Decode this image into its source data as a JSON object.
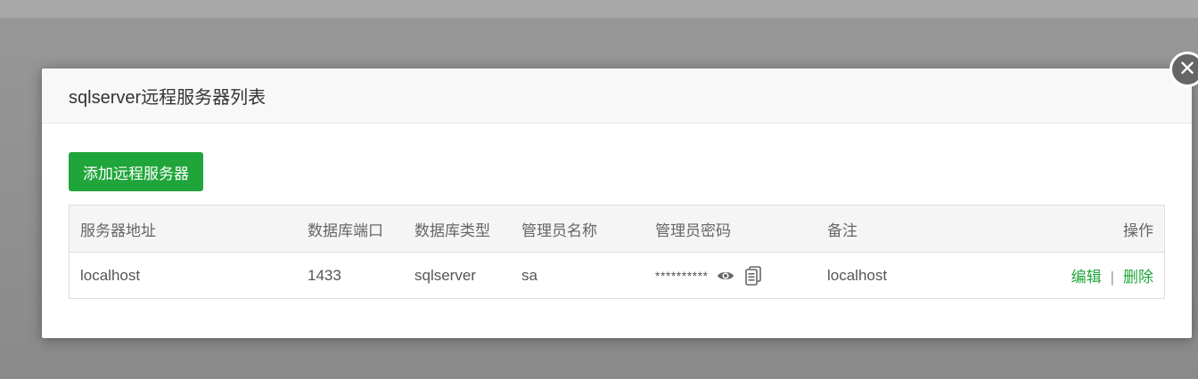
{
  "dialog": {
    "title": "sqlserver远程服务器列表",
    "close_glyph": "✕",
    "add_button_label": "添加远程服务器"
  },
  "table": {
    "columns": [
      "服务器地址",
      "数据库端口",
      "数据库类型",
      "管理员名称",
      "管理员密码",
      "备注",
      "操作"
    ],
    "rows": [
      {
        "host": "localhost",
        "port": "1433",
        "type": "sqlserver",
        "user": "sa",
        "password_mask": "**********",
        "note": "localhost",
        "edit_label": "编辑",
        "separator": "|",
        "delete_label": "删除"
      }
    ]
  },
  "icons": {
    "show_password": "eye-icon",
    "copy_password": "copy-icon",
    "close": "close-icon"
  },
  "colors": {
    "accent": "#20a53a",
    "close_bg": "#666666"
  }
}
